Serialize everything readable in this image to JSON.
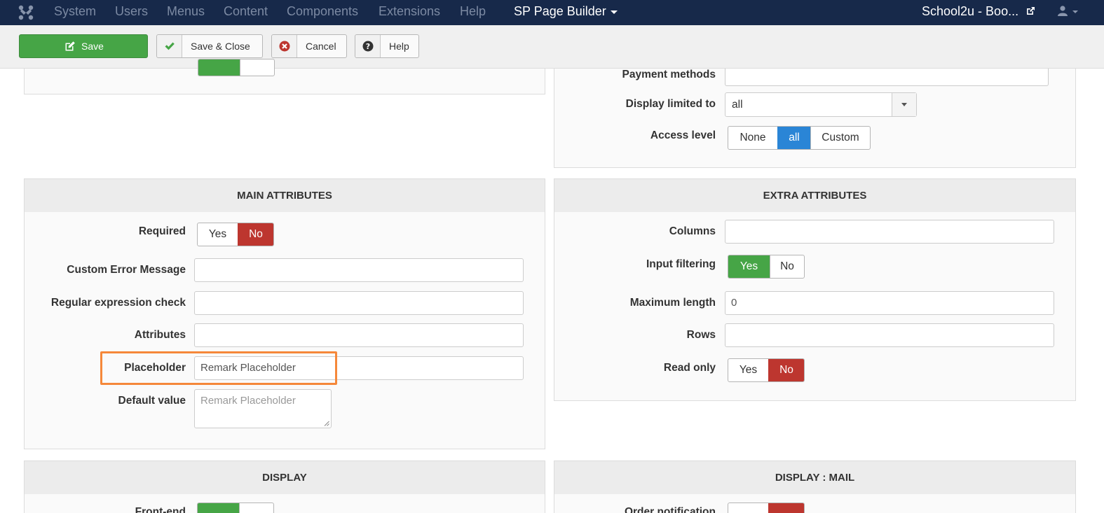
{
  "navbar": {
    "menu": [
      "System",
      "Users",
      "Menus",
      "Content",
      "Components",
      "Extensions",
      "Help"
    ],
    "brand": "SP Page Builder",
    "site_name": "School2u - Boo...",
    "icons": [
      "joomla-logo-icon",
      "external-link-icon",
      "user-icon",
      "caret-down-icon"
    ]
  },
  "toolbar": {
    "save_label": "Save",
    "save_close_label": "Save & Close",
    "cancel_label": "Cancel",
    "help_label": "Help"
  },
  "colors": {
    "navbar_bg": "#17294a",
    "save_green": "#46a546",
    "toggle_red": "#bd362f",
    "toggle_blue": "#2a85d6",
    "highlight_orange": "#f5883a"
  },
  "top_right_panel": {
    "payment_methods_label": "Payment methods",
    "payment_methods_value": "",
    "display_limited_label": "Display limited to",
    "display_limited_value": "all",
    "access_level_label": "Access level",
    "access_level_options": [
      "None",
      "all",
      "Custom"
    ],
    "access_level_selected": "all"
  },
  "main_attributes": {
    "title": "MAIN ATTRIBUTES",
    "required_label": "Required",
    "required_yes": "Yes",
    "required_no": "No",
    "required_selected": "No",
    "custom_error_label": "Custom Error Message",
    "custom_error_value": "",
    "regex_label": "Regular expression check",
    "regex_value": "",
    "attributes_label": "Attributes",
    "attributes_value": "",
    "placeholder_label": "Placeholder",
    "placeholder_value": "Remark Placeholder",
    "default_label": "Default value",
    "default_placeholder": "Remark Placeholder"
  },
  "extra_attributes": {
    "title": "EXTRA ATTRIBUTES",
    "columns_label": "Columns",
    "columns_value": "",
    "input_filtering_label": "Input filtering",
    "input_filtering_yes": "Yes",
    "input_filtering_no": "No",
    "input_filtering_selected": "Yes",
    "max_length_label": "Maximum length",
    "max_length_value": "0",
    "rows_label": "Rows",
    "rows_value": "",
    "read_only_label": "Read only",
    "read_only_yes": "Yes",
    "read_only_no": "No",
    "read_only_selected": "No"
  },
  "display_panel": {
    "title": "DISPLAY",
    "first_label_partial": "Front-end"
  },
  "display_mail_panel": {
    "title": "DISPLAY : MAIL",
    "first_label_partial": "Order notification"
  }
}
